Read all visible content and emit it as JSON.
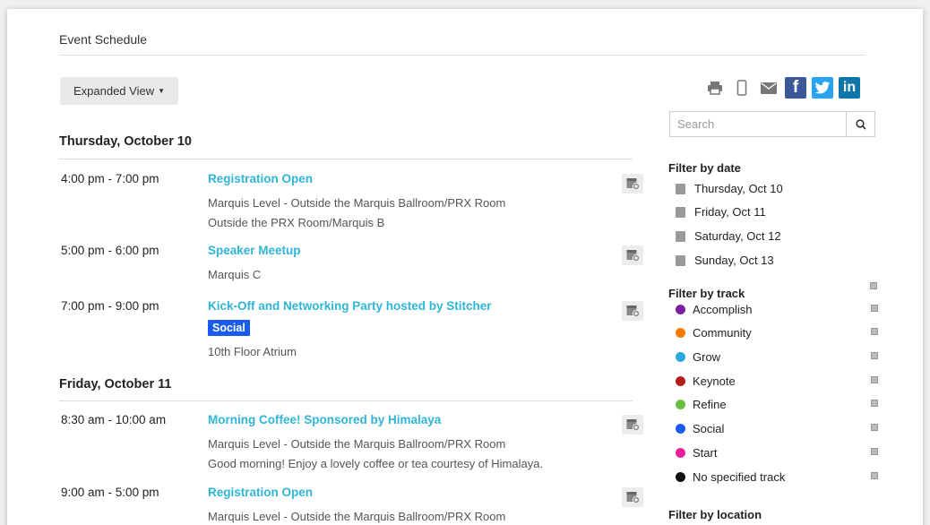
{
  "page": {
    "title": "Event Schedule"
  },
  "view_toggle": {
    "label": "Expanded View"
  },
  "days": [
    {
      "header": "Thursday, October 10",
      "events": [
        {
          "time": "4:00 pm - 7:00 pm",
          "title": "Registration Open",
          "lines": [
            "Marquis Level - Outside the Marquis Ballroom/PRX Room",
            "Outside the PRX Room/Marquis B"
          ]
        },
        {
          "time": "5:00 pm - 6:00 pm",
          "title": "Speaker Meetup",
          "lines": [
            "Marquis C"
          ]
        },
        {
          "time": "7:00 pm - 9:00 pm",
          "title": "Kick-Off and Networking Party hosted by Stitcher",
          "tag": "Social",
          "lines": [
            "10th Floor Atrium"
          ]
        }
      ]
    },
    {
      "header": "Friday, October 11",
      "events": [
        {
          "time": "8:30 am - 10:00 am",
          "title": "Morning Coffee! Sponsored by Himalaya",
          "lines": [
            "Marquis Level - Outside the Marquis Ballroom/PRX Room",
            "Good morning! Enjoy a lovely coffee or tea courtesy of Himalaya."
          ]
        },
        {
          "time": "9:00 am - 5:00 pm",
          "title": "Registration Open",
          "lines": [
            "Marquis Level - Outside the Marquis Ballroom/PRX Room"
          ]
        }
      ]
    }
  ],
  "share": {
    "icons": [
      "print-icon",
      "mobile-icon",
      "email-icon",
      "facebook-icon",
      "twitter-icon",
      "linkedin-icon"
    ],
    "facebook_glyph": "f",
    "linkedin_glyph": "in"
  },
  "search": {
    "placeholder": "Search"
  },
  "filters": {
    "date_heading": "Filter by date",
    "dates": [
      "Thursday, Oct 10",
      "Friday, Oct 11",
      "Saturday, Oct 12",
      "Sunday, Oct 13"
    ],
    "track_heading": "Filter by track",
    "tracks": [
      {
        "name": "Accomplish",
        "color": "#7b1fa2"
      },
      {
        "name": "Community",
        "color": "#f57c00"
      },
      {
        "name": "Grow",
        "color": "#29a8e0"
      },
      {
        "name": "Keynote",
        "color": "#b71c1c"
      },
      {
        "name": "Refine",
        "color": "#6abf40"
      },
      {
        "name": "Social",
        "color": "#1a5cf0"
      },
      {
        "name": "Start",
        "color": "#e91e9a"
      },
      {
        "name": "No specified track",
        "color": "#111111"
      }
    ],
    "location_heading": "Filter by location"
  }
}
